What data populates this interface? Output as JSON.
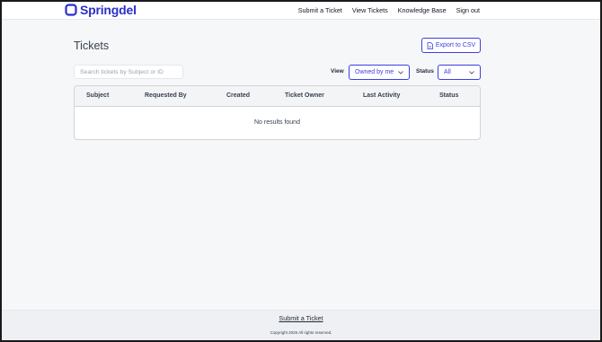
{
  "brand": {
    "name": "Springdel",
    "color": "#2a2fc9"
  },
  "nav": {
    "items": [
      {
        "label": "Submit a Ticket"
      },
      {
        "label": "View Tickets"
      },
      {
        "label": "Knowledge Base"
      },
      {
        "label": "Sign out"
      }
    ]
  },
  "page": {
    "title": "Tickets"
  },
  "toolbar": {
    "export_label": "Export to CSV",
    "export_icon": "file-icon",
    "search_placeholder": "Search tickets by Subject or ID",
    "search_value": "",
    "view_label": "View",
    "view_value": "Owned by me",
    "status_label": "Status",
    "status_value": "All"
  },
  "table": {
    "columns": [
      "Subject",
      "Requested By",
      "Created",
      "Ticket Owner",
      "Last Activity",
      "Status"
    ],
    "rows": [],
    "empty_message": "No results found"
  },
  "footer": {
    "link_label": "Submit a Ticket",
    "copyright": "Copyright 2025 All rights reserved."
  },
  "colors": {
    "accent": "#3b3fe0",
    "background": "#f6f7f9"
  }
}
